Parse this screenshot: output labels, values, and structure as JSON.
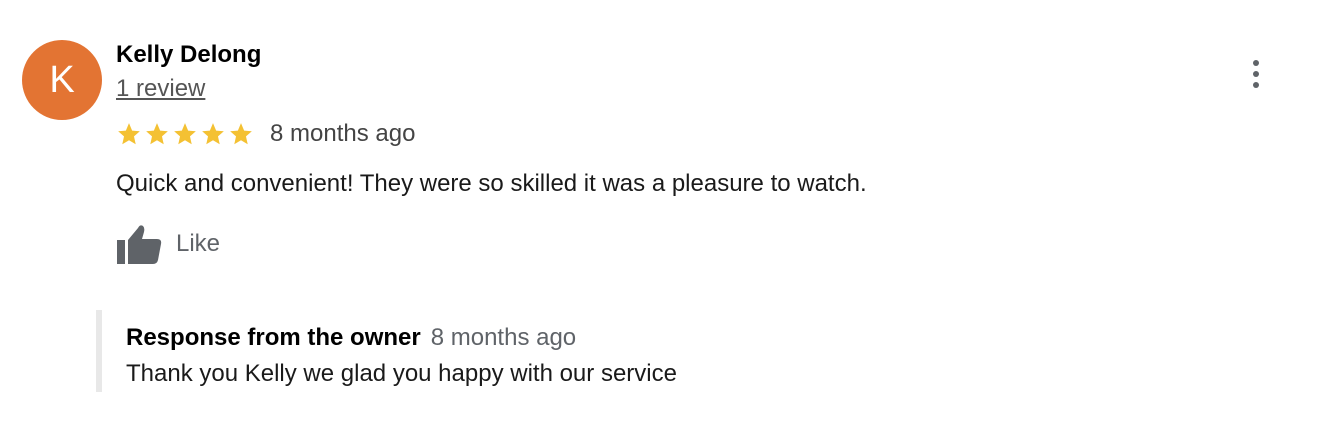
{
  "review": {
    "avatar_initial": "K",
    "avatar_color": "#e37433",
    "reviewer_name": "Kelly Delong",
    "review_count": "1 review",
    "rating": 5,
    "rating_max": 5,
    "star_color": "#f4c133",
    "time": "8 months ago",
    "text": "Quick and convenient! They were so skilled it was a pleasure to watch.",
    "like_icon": "thumbs-up-icon",
    "like_label": "Like",
    "more_icon": "more-vert-icon"
  },
  "owner_response": {
    "title": "Response from the owner",
    "time": "8 months ago",
    "text": "Thank you Kelly we glad you happy with our service"
  }
}
